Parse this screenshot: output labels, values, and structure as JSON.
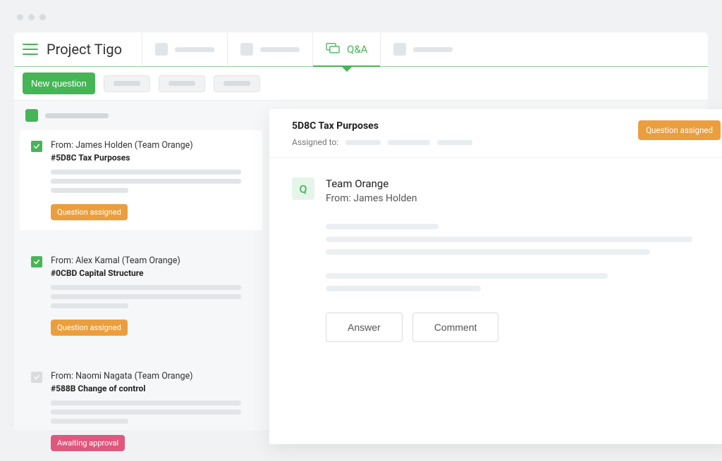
{
  "project_title": "Project Tigo",
  "tabs": {
    "active_label": "Q&A"
  },
  "toolbar": {
    "new_question_label": "New question"
  },
  "questions": [
    {
      "checked": true,
      "from_prefix": "From: ",
      "from": "James Holden (Team Orange)",
      "subject": "#5D8C Tax Purposes",
      "status_label": "Question assigned",
      "status_kind": "orange"
    },
    {
      "checked": true,
      "from_prefix": "From: ",
      "from": "Alex Kamal (Team Orange)",
      "subject": "#0CBD Capital Structure",
      "status_label": "Question assigned",
      "status_kind": "orange"
    },
    {
      "checked": false,
      "from_prefix": "From: ",
      "from": "Naomi Nagata (Team Orange)",
      "subject": "#588B Change of control",
      "status_label": "Awaiting approval",
      "status_kind": "pink"
    }
  ],
  "detail": {
    "title": "5D8C Tax Purposes",
    "assigned_label": "Assigned to:",
    "status_label": "Question assigned",
    "team": "Team Orange",
    "from_line": "From: James Holden",
    "q_glyph": "Q",
    "answer_label": "Answer",
    "comment_label": "Comment"
  }
}
